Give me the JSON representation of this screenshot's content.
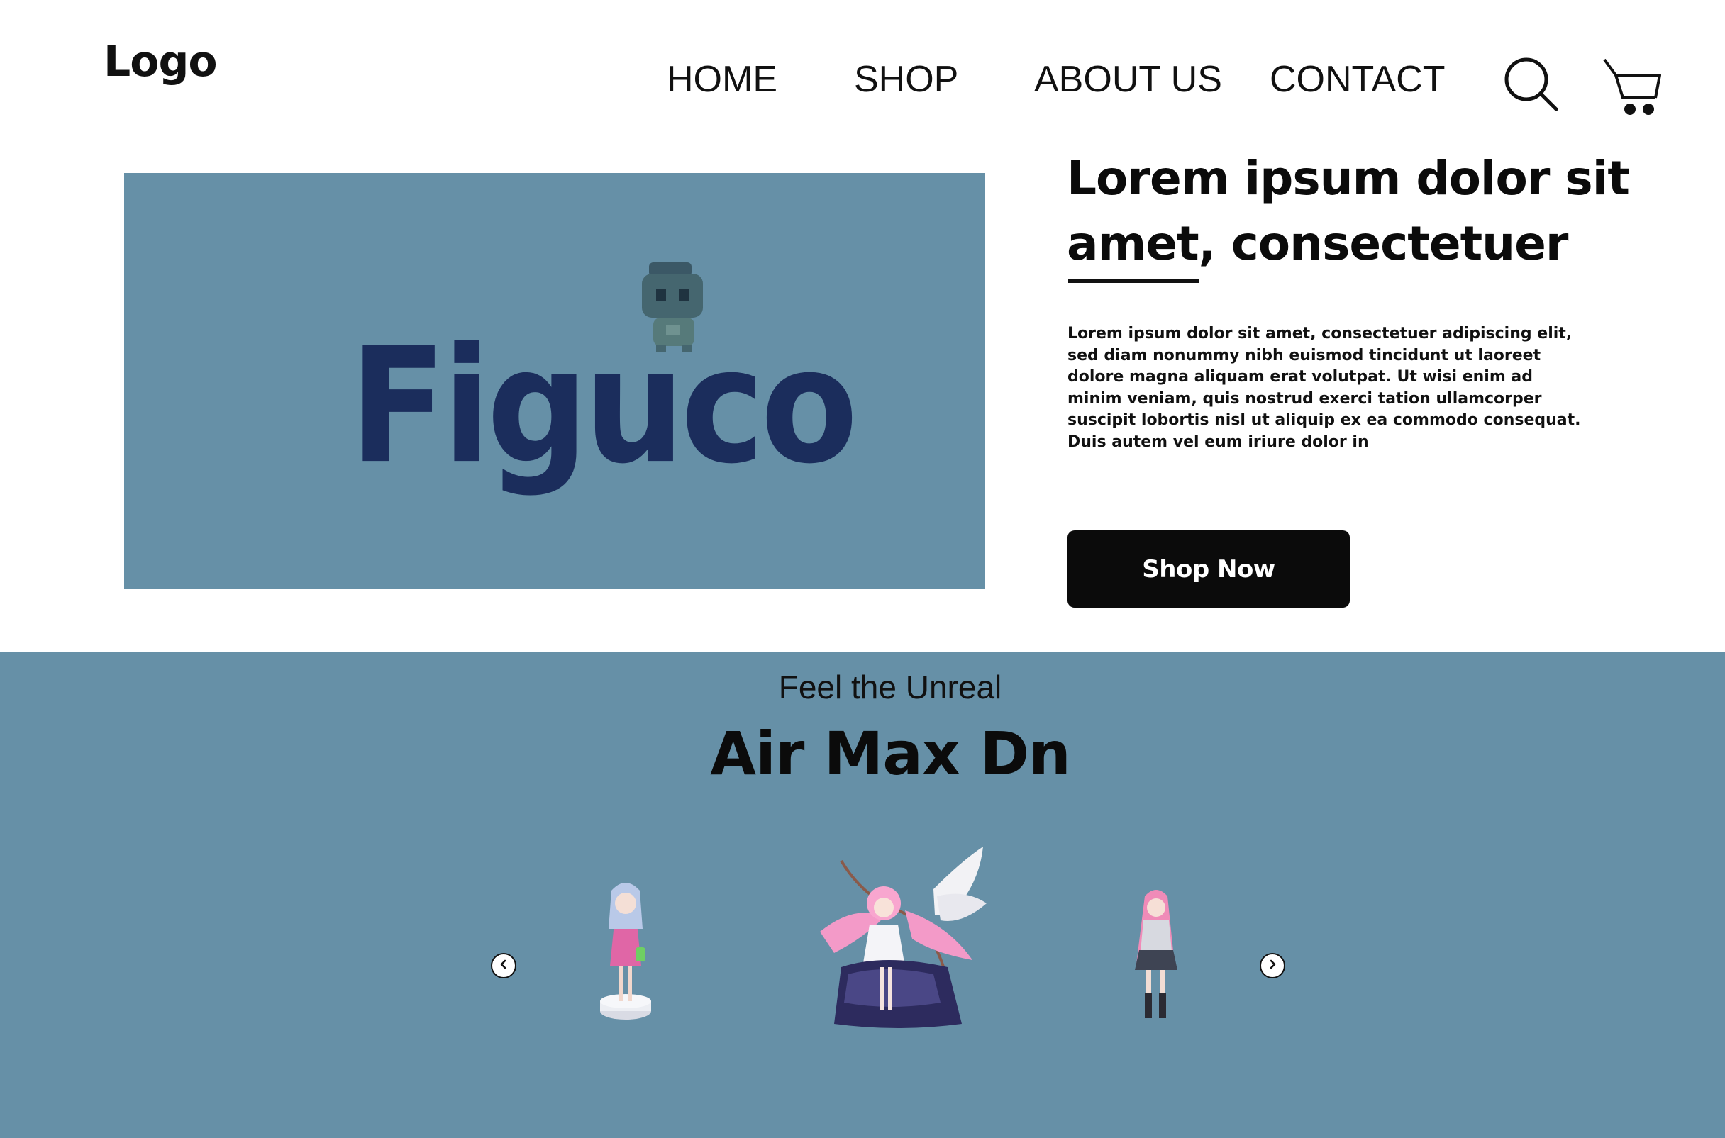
{
  "header": {
    "logo": "Logo",
    "nav": [
      "HOME",
      "SHOP",
      "ABOUT US",
      "CONTACT"
    ],
    "icons": [
      "search-icon",
      "cart-icon"
    ]
  },
  "hero": {
    "brand": "Figuco",
    "title": "Lorem ipsum dolor sit amet, consectetuer",
    "body": "Lorem ipsum dolor sit amet, consectetuer adipiscing elit, sed diam nonummy nibh euismod tincidunt ut laoreet dolore magna aliquam erat volutpat. Ut wisi enim ad minim veniam, quis nostrud exerci tation ullamcorper suscipit lobortis nisl ut aliquip ex ea commodo consequat. Duis autem vel eum iriure dolor in",
    "cta": "Shop Now"
  },
  "promo": {
    "kicker": "Feel the Unreal",
    "title": "Air Max Dn",
    "products": [
      "figure-pink-hoodie",
      "figure-winged-archer",
      "figure-schoolgirl"
    ]
  },
  "colors": {
    "panel": "#6690a7",
    "brand_text": "#1b2d5c",
    "button": "#0b0b0b"
  }
}
